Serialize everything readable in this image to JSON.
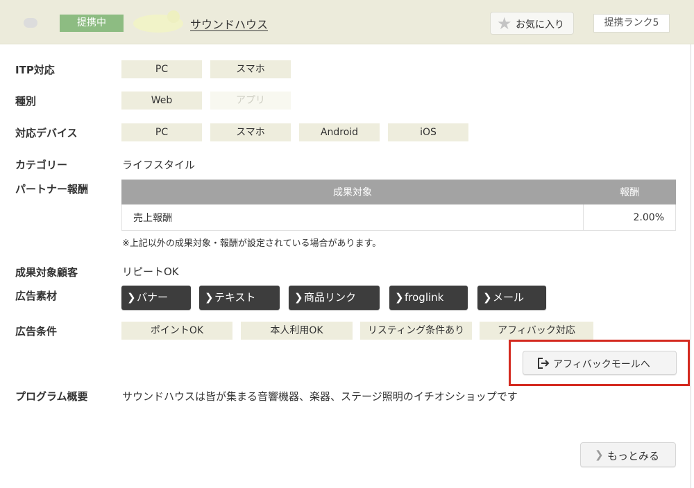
{
  "header": {
    "status_badge": "提携中",
    "advertiser_name": "サウンドハウス",
    "favorite_label": "お気に入り",
    "partner_rank": "提携ランク5"
  },
  "itp": {
    "label": "ITP対応",
    "tags": [
      "PC",
      "スマホ"
    ]
  },
  "type": {
    "label": "種別",
    "tags": [
      {
        "text": "Web",
        "enabled": true
      },
      {
        "text": "アプリ",
        "enabled": false
      }
    ]
  },
  "devices": {
    "label": "対応デバイス",
    "tags": [
      "PC",
      "スマホ",
      "Android",
      "iOS"
    ]
  },
  "category": {
    "label": "カテゴリー",
    "value": "ライフスタイル"
  },
  "reward": {
    "label": "パートナー報酬",
    "columns": [
      "成果対象",
      "報酬"
    ],
    "rows": [
      {
        "target": "売上報酬",
        "rate": "2.00%"
      }
    ],
    "note": "※上記以外の成果対象・報酬が設定されている場合があります。"
  },
  "customers": {
    "label": "成果対象顧客",
    "value": "リピートOK"
  },
  "materials": {
    "label": "広告素材",
    "buttons": [
      "バナー",
      "テキスト",
      "商品リンク",
      "froglink",
      "メール"
    ]
  },
  "conditions": {
    "label": "広告条件",
    "tags": [
      "ポイントOK",
      "本人利用OK",
      "リスティング条件あり",
      "アフィバック対応"
    ]
  },
  "mall_button": "アフィバックモールへ",
  "overview": {
    "label": "プログラム概要",
    "text": "サウンドハウスは皆が集まる音響機器、楽器、ステージ照明のイチオシショップです"
  },
  "more_button": "もっとみる",
  "colors": {
    "header_bg": "#ecebdb",
    "status_green": "#8dbc82",
    "tag_bg": "#eeeddd",
    "dark_button": "#3d3d3d",
    "highlight_red": "#d42a20"
  }
}
